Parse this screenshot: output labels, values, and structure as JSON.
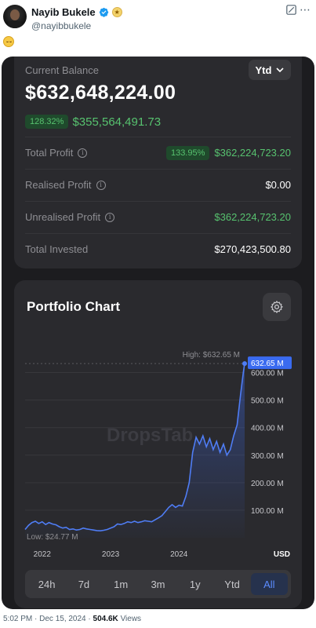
{
  "tweet": {
    "display_name": "Nayib Bukele",
    "handle": "@nayibbukele",
    "time": "5:02 PM · Dec 15, 2024",
    "separator": "·",
    "views_count": "504.6K",
    "views_label": "Views"
  },
  "app": {
    "current_balance_label": "Current Balance",
    "period_button": "Ytd",
    "balance": "$632,648,224.00",
    "change_pct": "128.32%",
    "change_amount": "$355,564,491.73",
    "accent_green": "#57c26f",
    "accent_blue": "#5b8cff",
    "rows": [
      {
        "label": "Total Profit",
        "badge": "133.95%",
        "value": "$362,224,723.20",
        "positive": true
      },
      {
        "label": "Realised Profit",
        "value": "$0.00",
        "positive": false
      },
      {
        "label": "Unrealised Profit",
        "value": "$362,224,723.20",
        "positive": true
      },
      {
        "label": "Total Invested",
        "value": "$270,423,500.80",
        "positive": false
      }
    ],
    "chart_title": "Portfolio Chart",
    "ranges": [
      "24h",
      "7d",
      "1m",
      "3m",
      "1y",
      "Ytd",
      "All"
    ],
    "active_range": "All"
  },
  "chart_data": {
    "type": "area",
    "title": "Portfolio Chart",
    "currency": "USD",
    "watermark": "DropsTab",
    "high_label": "High: $632.65 M",
    "low_label": "Low: $24.77 M",
    "current_value_label": "632.65 M",
    "x_ticks": [
      "2022",
      "2023",
      "2024"
    ],
    "y_ticks": [
      "100.00 M",
      "200.00 M",
      "300.00 M",
      "400.00 M",
      "500.00 M",
      "600.00 M"
    ],
    "ylim": [
      0,
      650
    ],
    "xlim": [
      2021.75,
      2024.96
    ],
    "series": [
      {
        "values": [
          [
            2021.75,
            30
          ],
          [
            2021.8,
            45
          ],
          [
            2021.85,
            55
          ],
          [
            2021.9,
            60
          ],
          [
            2021.95,
            52
          ],
          [
            2022.0,
            58
          ],
          [
            2022.05,
            48
          ],
          [
            2022.1,
            55
          ],
          [
            2022.15,
            50
          ],
          [
            2022.2,
            47
          ],
          [
            2022.25,
            40
          ],
          [
            2022.3,
            35
          ],
          [
            2022.35,
            38
          ],
          [
            2022.4,
            30
          ],
          [
            2022.45,
            32
          ],
          [
            2022.5,
            28
          ],
          [
            2022.55,
            30
          ],
          [
            2022.6,
            35
          ],
          [
            2022.65,
            32
          ],
          [
            2022.7,
            30
          ],
          [
            2022.75,
            28
          ],
          [
            2022.8,
            26
          ],
          [
            2022.85,
            25
          ],
          [
            2022.9,
            27
          ],
          [
            2022.95,
            30
          ],
          [
            2023.0,
            35
          ],
          [
            2023.05,
            40
          ],
          [
            2023.1,
            50
          ],
          [
            2023.15,
            48
          ],
          [
            2023.2,
            52
          ],
          [
            2023.25,
            58
          ],
          [
            2023.3,
            55
          ],
          [
            2023.35,
            60
          ],
          [
            2023.4,
            55
          ],
          [
            2023.45,
            58
          ],
          [
            2023.5,
            62
          ],
          [
            2023.55,
            60
          ],
          [
            2023.6,
            58
          ],
          [
            2023.65,
            65
          ],
          [
            2023.7,
            72
          ],
          [
            2023.75,
            80
          ],
          [
            2023.8,
            95
          ],
          [
            2023.85,
            110
          ],
          [
            2023.9,
            120
          ],
          [
            2023.95,
            110
          ],
          [
            2024.0,
            118
          ],
          [
            2024.05,
            115
          ],
          [
            2024.1,
            150
          ],
          [
            2024.15,
            200
          ],
          [
            2024.2,
            310
          ],
          [
            2024.25,
            365
          ],
          [
            2024.3,
            340
          ],
          [
            2024.35,
            370
          ],
          [
            2024.4,
            330
          ],
          [
            2024.45,
            360
          ],
          [
            2024.5,
            320
          ],
          [
            2024.55,
            350
          ],
          [
            2024.6,
            310
          ],
          [
            2024.65,
            340
          ],
          [
            2024.7,
            300
          ],
          [
            2024.75,
            320
          ],
          [
            2024.8,
            370
          ],
          [
            2024.85,
            410
          ],
          [
            2024.9,
            520
          ],
          [
            2024.94,
            600
          ],
          [
            2024.96,
            632.65
          ]
        ]
      }
    ]
  }
}
